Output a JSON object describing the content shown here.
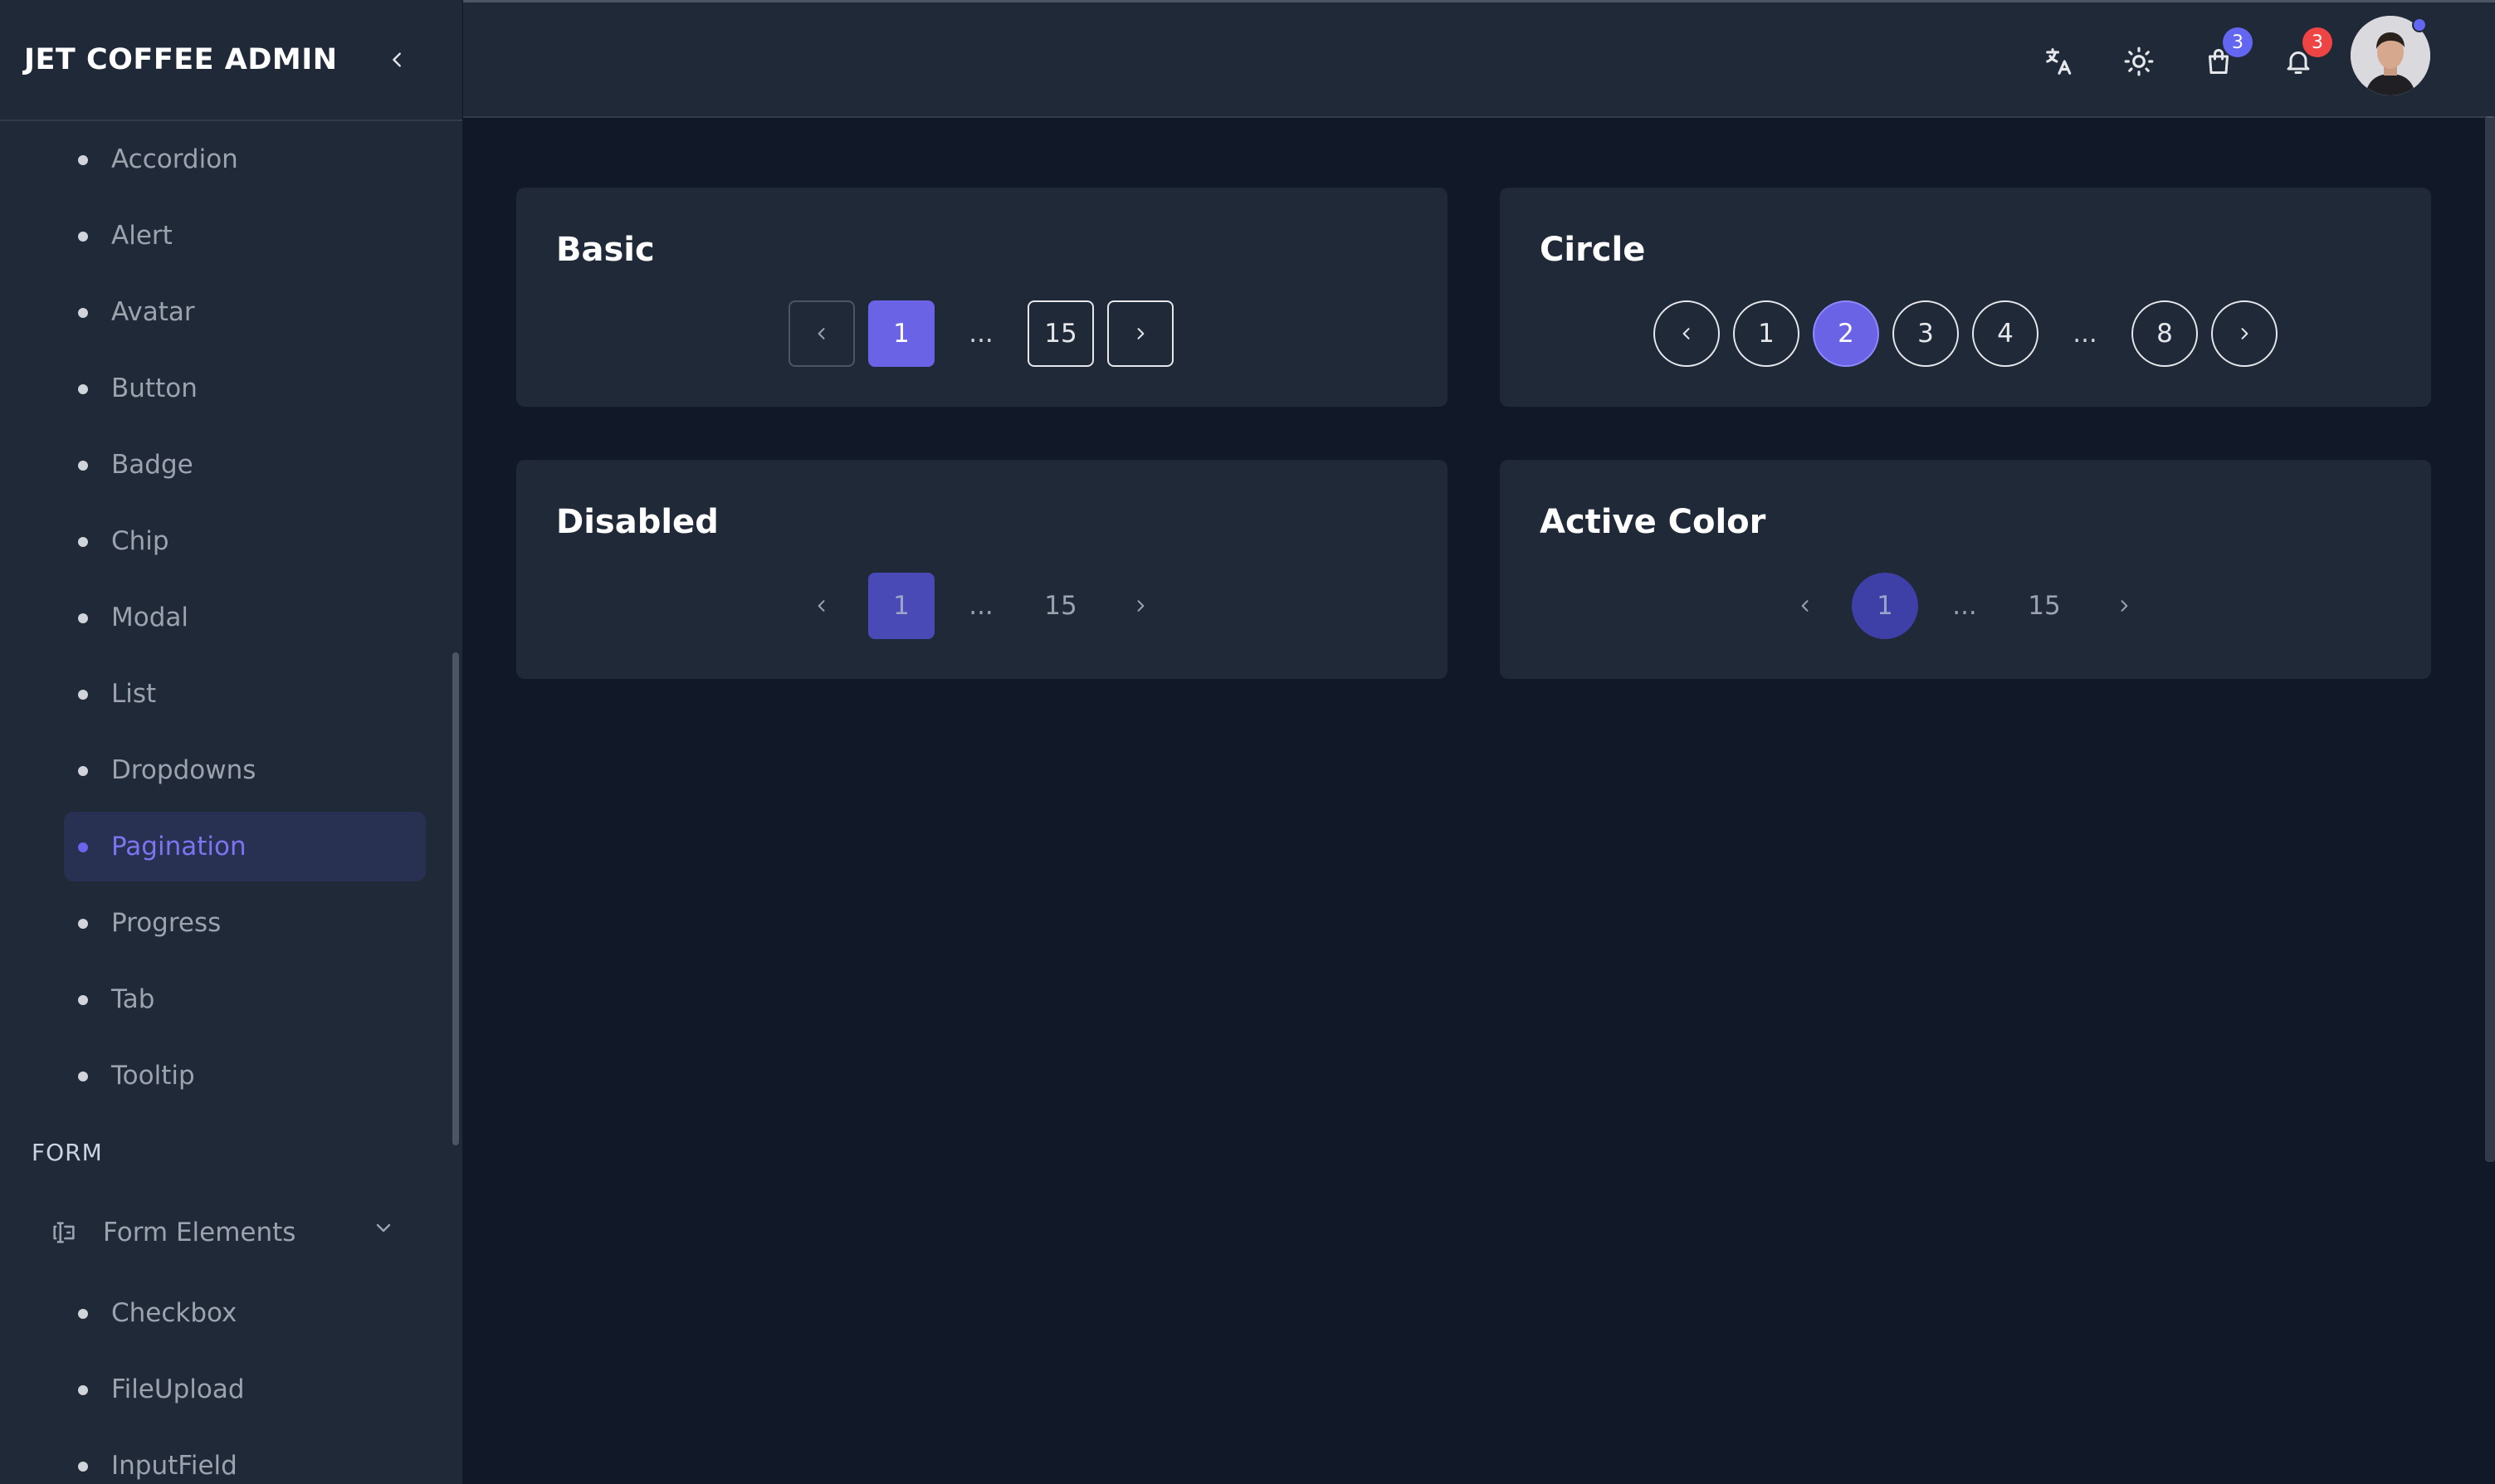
{
  "brand": {
    "title": "JET COFFEE ADMIN"
  },
  "sidebar": {
    "items": [
      {
        "label": "Accordion"
      },
      {
        "label": "Alert"
      },
      {
        "label": "Avatar"
      },
      {
        "label": "Button"
      },
      {
        "label": "Badge"
      },
      {
        "label": "Chip"
      },
      {
        "label": "Modal"
      },
      {
        "label": "List"
      },
      {
        "label": "Dropdowns"
      },
      {
        "label": "Pagination",
        "active": true
      },
      {
        "label": "Progress"
      },
      {
        "label": "Tab"
      },
      {
        "label": "Tooltip"
      }
    ],
    "section_form": "FORM",
    "form_group": {
      "label": "Form Elements"
    },
    "form_items": [
      {
        "label": "Checkbox"
      },
      {
        "label": "FileUpload"
      },
      {
        "label": "InputField"
      }
    ]
  },
  "topbar": {
    "icons": [
      "translate-icon",
      "sun-icon",
      "shopping-bag-icon",
      "bell-icon"
    ],
    "cart_badge": "3",
    "notification_badge": "3"
  },
  "cards": {
    "basic": {
      "title": "Basic",
      "pages": [
        "1",
        "...",
        "15"
      ]
    },
    "circle": {
      "title": "Circle",
      "pages": [
        "1",
        "2",
        "3",
        "4",
        "...",
        "8"
      ]
    },
    "disabled": {
      "title": "Disabled",
      "pages": [
        "1",
        "...",
        "15"
      ]
    },
    "active_color": {
      "title": "Active Color",
      "pages": [
        "1",
        "...",
        "15"
      ]
    }
  },
  "colors": {
    "accent": "#6b63e6",
    "background": "#111827",
    "surface": "#1f2937",
    "danger": "#ef4444"
  }
}
